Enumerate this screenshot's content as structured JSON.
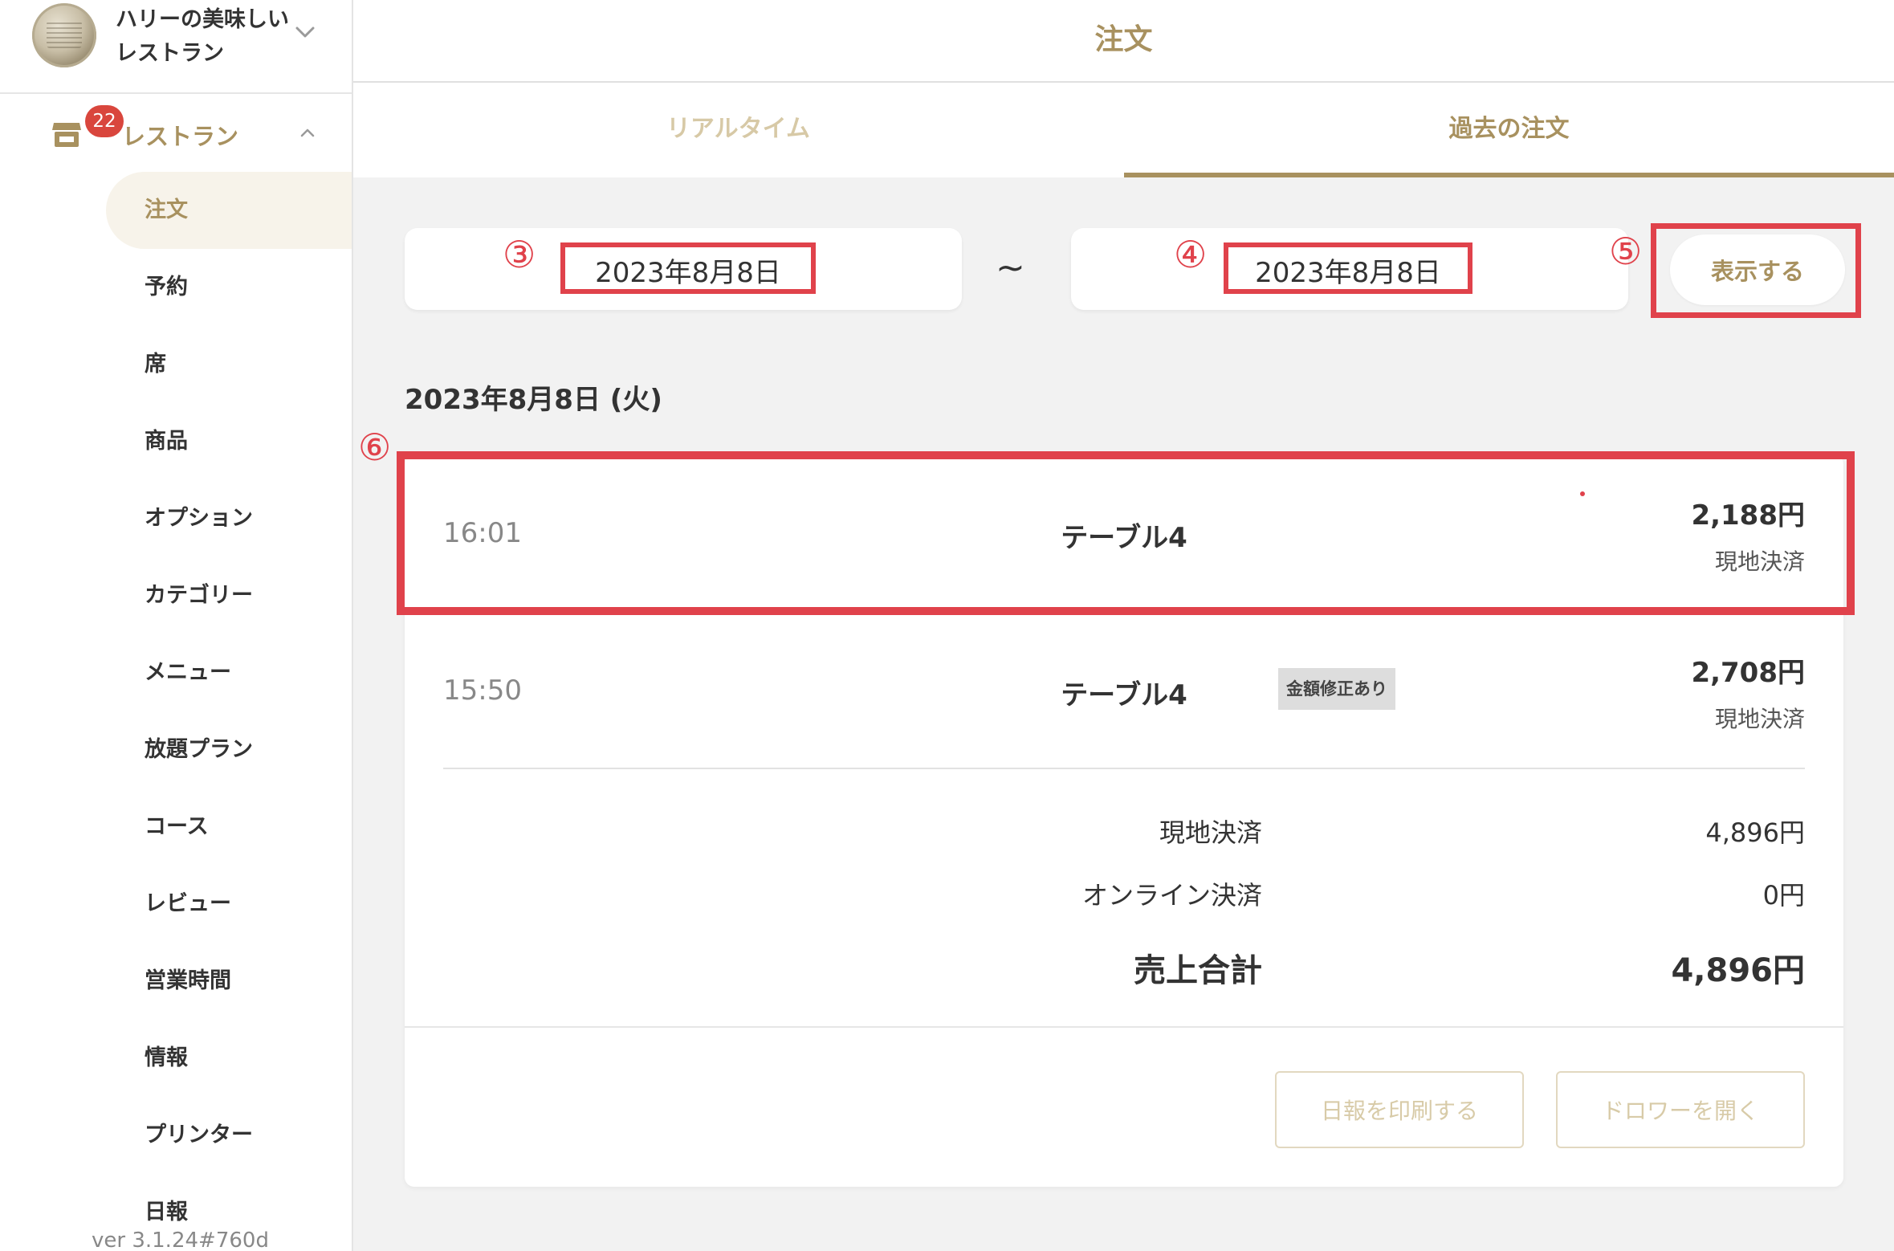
{
  "store": {
    "name_line1": "ハリーの美味しい",
    "name_line2": "レストラン"
  },
  "sidebar": {
    "section_label": "レストラン",
    "badge_count": "22",
    "items": [
      {
        "label": "注文",
        "active": true
      },
      {
        "label": "予約"
      },
      {
        "label": "席"
      },
      {
        "label": "商品"
      },
      {
        "label": "オプション"
      },
      {
        "label": "カテゴリー"
      },
      {
        "label": "メニュー"
      },
      {
        "label": "放題プラン"
      },
      {
        "label": "コース"
      },
      {
        "label": "レビュー"
      },
      {
        "label": "営業時間"
      },
      {
        "label": "情報"
      },
      {
        "label": "プリンター"
      },
      {
        "label": "日報"
      }
    ],
    "version": "ver 3.1.24#760d"
  },
  "header": {
    "title": "注文"
  },
  "tabs": [
    {
      "label": "リアルタイム",
      "active": false
    },
    {
      "label": "過去の注文",
      "active": true
    }
  ],
  "filter": {
    "start_date": "2023年8月8日",
    "end_date": "2023年8月8日",
    "separator": "~",
    "show_button": "表示する",
    "markers": {
      "m3": "③",
      "m4": "④",
      "m5": "⑤",
      "m6": "⑥"
    }
  },
  "day": {
    "heading": "2023年8月8日 (火)",
    "orders": [
      {
        "time": "16:01",
        "table": "テーブル4",
        "amount": "2,188円",
        "payment": "現地決済",
        "note": ""
      },
      {
        "time": "15:50",
        "table": "テーブル4",
        "amount": "2,708円",
        "payment": "現地決済",
        "note": "金額修正あり"
      }
    ],
    "summary": {
      "onsite_label": "現地決済",
      "onsite_value": "4,896円",
      "online_label": "オンライン決済",
      "online_value": "0円",
      "total_label": "売上合計",
      "total_value": "4,896円"
    }
  },
  "actions": {
    "print_report": "日報を印刷する",
    "open_drawer": "ドロワーを開く"
  },
  "colors": {
    "accent": "#a8915f",
    "highlight_frame": "#e0424b",
    "badge": "#d9463d"
  }
}
